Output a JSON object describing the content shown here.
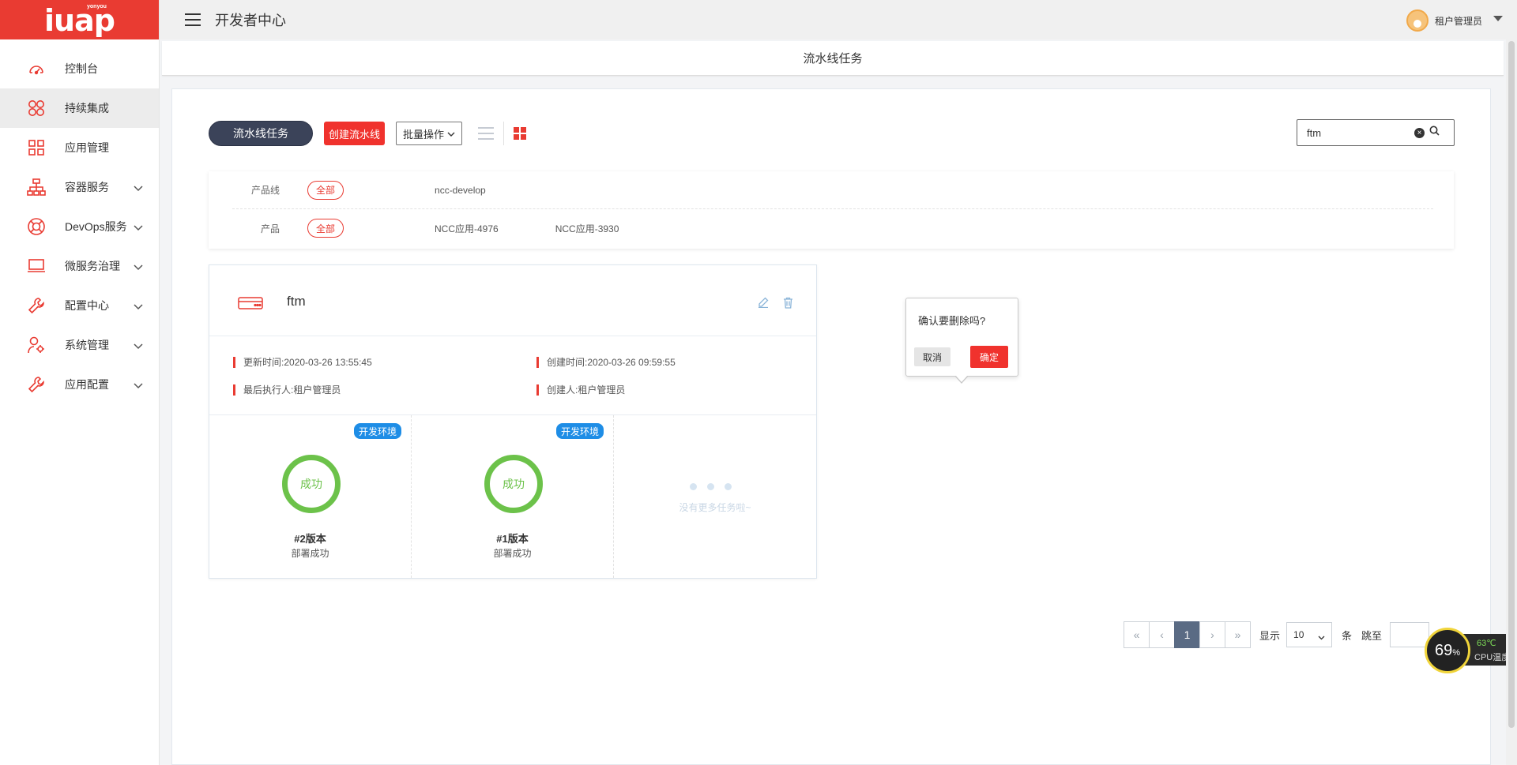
{
  "logo": {
    "main": "iuap",
    "sub": "yonyou"
  },
  "header": {
    "title": "开发者中心",
    "user_name": "租户管理员"
  },
  "subheader": {
    "title": "流水线任务"
  },
  "sidebar": {
    "items": [
      {
        "label": "控制台",
        "icon": "dashboard-icon",
        "has_children": false
      },
      {
        "label": "持续集成",
        "icon": "ci-flower-icon",
        "has_children": false,
        "active": true
      },
      {
        "label": "应用管理",
        "icon": "apps-grid-icon",
        "has_children": false
      },
      {
        "label": "容器服务",
        "icon": "network-icon",
        "has_children": true
      },
      {
        "label": "DevOps服务",
        "icon": "lifebuoy-icon",
        "has_children": true
      },
      {
        "label": "微服务治理",
        "icon": "laptop-icon",
        "has_children": true
      },
      {
        "label": "配置中心",
        "icon": "wrench-icon",
        "has_children": true
      },
      {
        "label": "系统管理",
        "icon": "user-gear-icon",
        "has_children": true
      },
      {
        "label": "应用配置",
        "icon": "wrench-icon",
        "has_children": true
      }
    ]
  },
  "toolbar": {
    "pipeline_tasks_label": "流水线任务",
    "create_pipeline_label": "创建流水线",
    "batch_ops_label": "批量操作"
  },
  "search": {
    "value": "ftm"
  },
  "filter": {
    "product_line": {
      "label": "产品线",
      "all": "全部",
      "options": [
        "ncc-develop"
      ]
    },
    "product": {
      "label": "产品",
      "all": "全部",
      "options": [
        "NCC应用-4976",
        "NCC应用-3930"
      ]
    }
  },
  "card": {
    "name": "ftm",
    "update_time_label": "更新时间:",
    "update_time": "2020-03-26 13:55:45",
    "create_time_label": "创建时间:",
    "create_time": "2020-03-26 09:59:55",
    "last_executor_label": "最后执行人:",
    "last_executor": "租户管理员",
    "creator_label": "创建人:",
    "creator": "租户管理员",
    "tasks": [
      {
        "env": "开发环境",
        "status": "成功",
        "version": "#2版本",
        "desc": "部署成功"
      },
      {
        "env": "开发环境",
        "status": "成功",
        "version": "#1版本",
        "desc": "部署成功"
      }
    ],
    "no_more": "没有更多任务啦~"
  },
  "popconfirm": {
    "message": "确认要删除吗?",
    "cancel": "取消",
    "ok": "确定"
  },
  "pagination": {
    "current_page": "1",
    "show_label": "显示",
    "page_size": "10",
    "unit": "条",
    "jump_label": "跳至"
  },
  "cpu_widget": {
    "percent": "69",
    "percent_sign": "%",
    "temperature": "63℃",
    "label": "CPU温度"
  },
  "colors": {
    "brand_red": "#e93b32",
    "success_green": "#6cc24a",
    "env_blue": "#1e8de6",
    "dark_button": "#3b4359"
  }
}
